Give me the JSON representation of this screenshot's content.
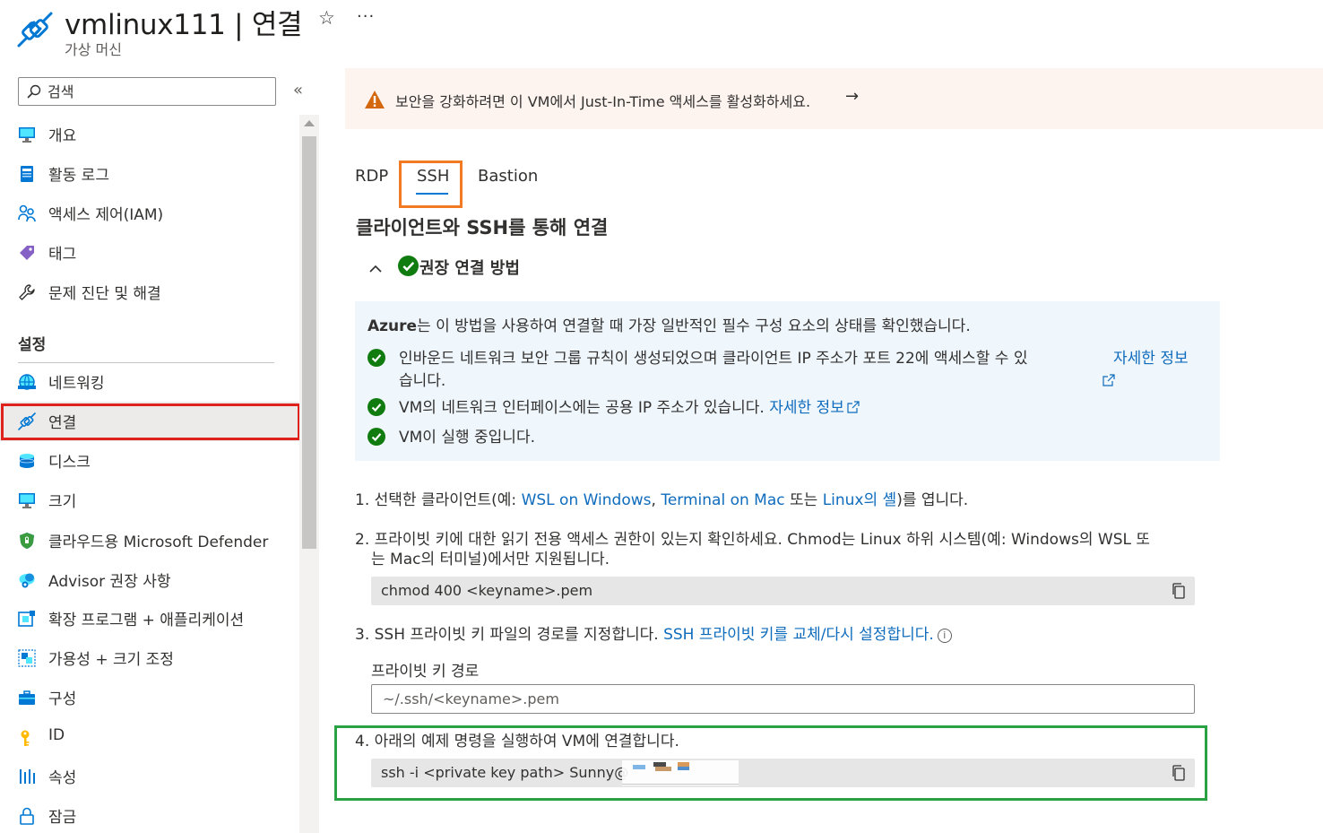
{
  "header": {
    "title": "vmlinux111 | 연결",
    "subtitle": "가상 머신",
    "favorite_icon": "star-icon",
    "more_label": "···"
  },
  "sidebar": {
    "search_placeholder": "검색",
    "collapse_label": "«",
    "items_top": [
      {
        "label": "개요",
        "icon": "monitor-icon"
      },
      {
        "label": "활동 로그",
        "icon": "log-icon"
      },
      {
        "label": "액세스 제어(IAM)",
        "icon": "people-icon"
      },
      {
        "label": "태그",
        "icon": "tag-icon"
      },
      {
        "label": "문제 진단 및 해결",
        "icon": "wrench-icon"
      }
    ],
    "section_label": "설정",
    "items_settings": [
      {
        "label": "네트워킹",
        "icon": "network-icon"
      },
      {
        "label": "연결",
        "icon": "connect-icon"
      },
      {
        "label": "디스크",
        "icon": "disk-icon"
      },
      {
        "label": "크기",
        "icon": "monitor-icon"
      },
      {
        "label": "클라우드용 Microsoft Defender",
        "icon": "shield-icon"
      },
      {
        "label": "Advisor 권장 사항",
        "icon": "advisor-icon"
      },
      {
        "label": "확장 프로그램 + 애플리케이션",
        "icon": "extensions-icon"
      },
      {
        "label": "가용성 + 크기 조정",
        "icon": "availability-icon"
      },
      {
        "label": "구성",
        "icon": "toolbox-icon"
      },
      {
        "label": "ID",
        "icon": "key-icon"
      },
      {
        "label": "속성",
        "icon": "properties-icon"
      },
      {
        "label": "잠금",
        "icon": "lock-icon"
      }
    ]
  },
  "banner": {
    "text": "보안을 강화하려면 이 VM에서 Just-In-Time 액세스를 활성화하세요.",
    "arrow": "→"
  },
  "tabs": [
    "RDP",
    "SSH",
    "Bastion"
  ],
  "main": {
    "title": "클라이언트와 SSH를 통해 연결",
    "recommended_title": "권장 연결 방법",
    "info": {
      "intro_brand": "Azure",
      "intro_rest": "는 이 방법을 사용하여 연결할 때 가장 일반적인 필수 구성 요소의 상태를 확인했습니다.",
      "checks": [
        {
          "text_line1": "인바운드 네트워크 보안 그룹 규칙이 생성되었으며 클라이언트 IP 주소가 포트 22에 액세스할 수 있",
          "text_line2": "습니다.",
          "link": "자세한 정보"
        },
        {
          "text": "VM의 네트워크 인터페이스에는 공용 IP 주소가 있습니다.",
          "link": "자세한 정보"
        },
        {
          "text": "VM이 실행 중입니다."
        }
      ]
    },
    "steps": {
      "s1_prefix": "1. 선택한 클라이언트(예: ",
      "s1_link1": "WSL on Windows",
      "s1_sep": ", ",
      "s1_link2": "Terminal on Mac",
      "s1_mid": " 또는 ",
      "s1_link3": "Linux의 셸",
      "s1_suffix": ")를 엽니다.",
      "s2_line1": "2. 프라이빗 키에 대한 읽기 전용 액세스 권한이 있는지 확인하세요. Chmod는 Linux 하위 시스템(예: Windows의 WSL 또",
      "s2_line2": "는 Mac의 터미널)에서만 지원됩니다.",
      "s2_code": "chmod 400 <keyname>.pem",
      "s3_text": "3. SSH 프라이빗 키 파일의 경로를 지정합니다. ",
      "s3_link": "SSH 프라이빗 키를 교체/다시 설정합니다.",
      "s3_info": "i",
      "key_path_label": "프라이빗 키 경로",
      "key_path_placeholder": "~/.ssh/<keyname>.pem",
      "s4_text": "4. 아래의 예제 명령을 실행하여 VM에 연결합니다.",
      "s4_code": "ssh -i <private key path> Sunny@"
    }
  },
  "colors": {
    "accent": "#0078d4",
    "link": "#0f6cbd",
    "success": "#107c10",
    "warning": "#d4680f",
    "highlight_red": "#e0221d",
    "highlight_orange": "#f27a22",
    "highlight_green": "#2aa243"
  }
}
